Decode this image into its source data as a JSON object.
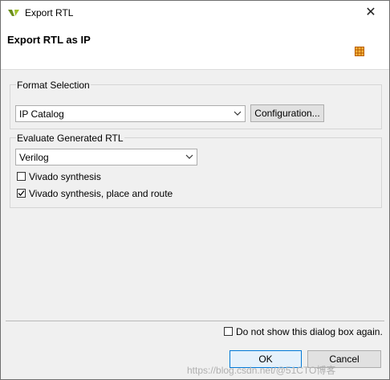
{
  "window": {
    "title": "Export RTL",
    "close_glyph": "✕"
  },
  "header": {
    "title": "Export RTL as IP",
    "icon": "ip-grid-icon"
  },
  "format_selection": {
    "label": "Format Selection",
    "format_value": "IP Catalog",
    "configuration_label": "Configuration..."
  },
  "evaluate": {
    "label": "Evaluate Generated RTL",
    "language_value": "Verilog",
    "options": [
      {
        "label": "Vivado synthesis",
        "checked": false
      },
      {
        "label": "Vivado synthesis, place and route",
        "checked": true
      }
    ]
  },
  "footer": {
    "dont_show_label": "Do not show this dialog box again.",
    "dont_show_checked": false,
    "ok_label": "OK",
    "cancel_label": "Cancel"
  },
  "watermark": "https://blog.csdn.net/@51CTO博客"
}
